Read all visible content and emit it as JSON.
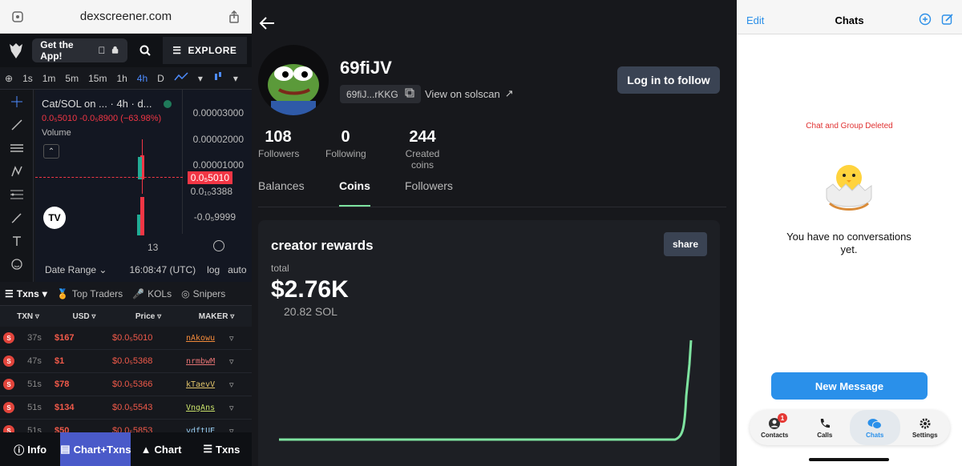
{
  "left": {
    "url": "dexscreener.com",
    "get_app": "Get the App!",
    "explore": "EXPLORE",
    "timeframes": [
      "1s",
      "1m",
      "5m",
      "15m",
      "1h",
      "4h",
      "D"
    ],
    "active_timeframe": "4h",
    "chart": {
      "title": "Cat/SOL on ... · 4h · d...",
      "ohlc": "0.0₅5010  -0.0₅8900 (−63.98%)",
      "volume_label": "Volume",
      "y_labels": [
        "0.00003000",
        "0.00002000",
        "0.00001000",
        "0.0₁₀3388",
        "-0.0₅9999"
      ],
      "price_tag": "0.0₅5010",
      "x_label": "13"
    },
    "chart_bottom": {
      "date_range": "Date Range",
      "time": "16:08:47 (UTC)",
      "log": "log",
      "auto": "auto"
    },
    "tabs": [
      "Txns",
      "Top Traders",
      "KOLs",
      "Snipers"
    ],
    "table_headers": [
      "TXN",
      "USD",
      "Price",
      "MAKER"
    ],
    "rows": [
      {
        "type": "S",
        "age": "37s",
        "usd": "$167",
        "price": "$0.0₅5010",
        "maker": "nAkowu"
      },
      {
        "type": "S",
        "age": "47s",
        "usd": "$1",
        "price": "$0.0₅5368",
        "maker": "nrmbwM"
      },
      {
        "type": "S",
        "age": "51s",
        "usd": "$78",
        "price": "$0.0₅5366",
        "maker": "kTaevV"
      },
      {
        "type": "S",
        "age": "51s",
        "usd": "$134",
        "price": "$0.0₅5543",
        "maker": "VngAns"
      },
      {
        "type": "S",
        "age": "51s",
        "usd": "$50",
        "price": "$0.0₅5853",
        "maker": "vdftUE"
      }
    ],
    "bottom_nav": [
      "Info",
      "Chart+Txns",
      "Chart",
      "Txns"
    ],
    "active_nav": "Chart+Txns"
  },
  "mid": {
    "username": "69fiJV",
    "address": "69fiJ...rKKG",
    "solscan": "View on solscan",
    "follow": "Log in to follow",
    "stats": [
      {
        "n": "108",
        "l": "Followers"
      },
      {
        "n": "0",
        "l": "Following"
      },
      {
        "n": "244",
        "l": "Created coins"
      }
    ],
    "tabs": [
      "Balances",
      "Coins",
      "Followers"
    ],
    "active_tab": "Coins",
    "card": {
      "title": "creator rewards",
      "share": "share",
      "total_label": "total",
      "total_value": "$2.76K",
      "total_sol": "20.82 SOL"
    }
  },
  "right": {
    "edit": "Edit",
    "title": "Chats",
    "deleted": "Chat and Group Deleted",
    "empty": "You have no conversations yet.",
    "new_message": "New Message",
    "tabs": [
      {
        "label": "Contacts",
        "badge": "1"
      },
      {
        "label": "Calls"
      },
      {
        "label": "Chats"
      },
      {
        "label": "Settings"
      }
    ],
    "active_tab": "Chats"
  },
  "colors": {
    "accent_blue": "#2a90ea",
    "sell_red": "#e2443b",
    "green_line": "#7ee3a0",
    "nav_active": "#4a5ac9"
  }
}
